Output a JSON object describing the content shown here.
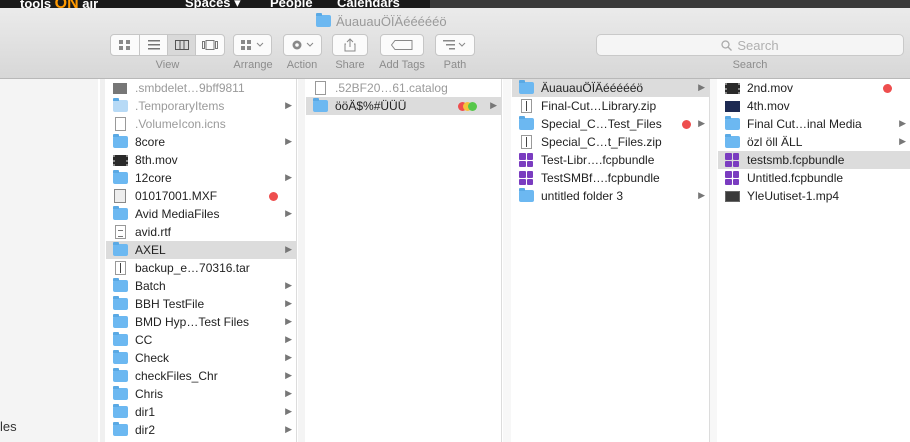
{
  "background": {
    "logo_a": "tools ",
    "logo_b": "ON",
    "logo_c": " air",
    "menu": [
      "Spaces ▾",
      "People",
      "Calendars"
    ]
  },
  "window": {
    "title": "ÄuauauÖÏÄéééééö",
    "sidebar_fragment": "les"
  },
  "toolbar": {
    "view_label": "View",
    "arrange_label": "Arrange",
    "action_label": "Action",
    "share_label": "Share",
    "add_tags_label": "Add Tags",
    "path_label": "Path",
    "search_label": "Search",
    "search_placeholder": "Search"
  },
  "colors": {
    "tag_red": "#ee4e4e",
    "tag_yellow": "#f5c33b",
    "tag_green": "#56c74a",
    "folder": "#6cb8f1"
  },
  "columns": [
    {
      "items": [
        {
          "name": ".smbdelet…9bff9811",
          "icon": "gray",
          "dim": true
        },
        {
          "name": ".TemporaryItems",
          "icon": "folder-light",
          "dim": true,
          "chevron": true
        },
        {
          "name": ".VolumeIcon.icns",
          "icon": "doc",
          "dim": true
        },
        {
          "name": "8core",
          "icon": "folder",
          "chevron": true
        },
        {
          "name": "8th.mov",
          "icon": "mov"
        },
        {
          "name": "12core",
          "icon": "folder",
          "chevron": true
        },
        {
          "name": "01017001.MXF",
          "icon": "mxf",
          "tag": "red"
        },
        {
          "name": "Avid MediaFiles",
          "icon": "folder",
          "chevron": true
        },
        {
          "name": "avid.rtf",
          "icon": "rtf"
        },
        {
          "name": "AXEL",
          "icon": "folder",
          "chevron": true,
          "selected": true
        },
        {
          "name": "backup_e…70316.tar",
          "icon": "zip"
        },
        {
          "name": "Batch",
          "icon": "folder",
          "chevron": true
        },
        {
          "name": "BBH TestFile",
          "icon": "folder",
          "chevron": true
        },
        {
          "name": "BMD Hyp…Test Files",
          "icon": "folder",
          "chevron": true
        },
        {
          "name": "CC",
          "icon": "folder",
          "chevron": true
        },
        {
          "name": "Check",
          "icon": "folder",
          "chevron": true
        },
        {
          "name": "checkFiles_Chr",
          "icon": "folder",
          "chevron": true
        },
        {
          "name": "Chris",
          "icon": "folder",
          "chevron": true
        },
        {
          "name": "dir1",
          "icon": "folder",
          "chevron": true
        },
        {
          "name": "dir2",
          "icon": "folder",
          "chevron": true
        }
      ]
    },
    {
      "items": [
        {
          "name": ".52BF20…61.catalog",
          "icon": "doc",
          "dim": true
        },
        {
          "name": "ööÄ$%#ÜÜÜ",
          "icon": "folder",
          "chevron": true,
          "selected": true,
          "tags": [
            "red",
            "yellow",
            "green"
          ]
        }
      ]
    },
    {
      "items": [
        {
          "name": "ÄuauauÖÏÄéééééö",
          "icon": "folder",
          "chevron": true,
          "selected": true
        },
        {
          "name": "Final-Cut…Library.zip",
          "icon": "zip"
        },
        {
          "name": "Special_C…Test_Files",
          "icon": "folder",
          "chevron": true,
          "tag": "red"
        },
        {
          "name": "Special_C…t_Files.zip",
          "icon": "zip"
        },
        {
          "name": "Test-Libr….fcpbundle",
          "icon": "bundle"
        },
        {
          "name": "TestSMBf….fcpbundle",
          "icon": "bundle"
        },
        {
          "name": "untitled folder 3",
          "icon": "folder",
          "chevron": true
        }
      ]
    },
    {
      "items": [
        {
          "name": "2nd.mov",
          "icon": "mov",
          "tag": "red"
        },
        {
          "name": "4th.mov",
          "icon": "mov2"
        },
        {
          "name": "Final Cut…inal Media",
          "icon": "folder",
          "chevron": true
        },
        {
          "name": "özl öll ÄLL",
          "icon": "folder",
          "chevron": true
        },
        {
          "name": "testsmb.fcpbundle",
          "icon": "bundle",
          "selected": true
        },
        {
          "name": "Untitled.fcpbundle",
          "icon": "bundle"
        },
        {
          "name": "YleUutiset-1.mp4",
          "icon": "mp4"
        }
      ]
    }
  ]
}
